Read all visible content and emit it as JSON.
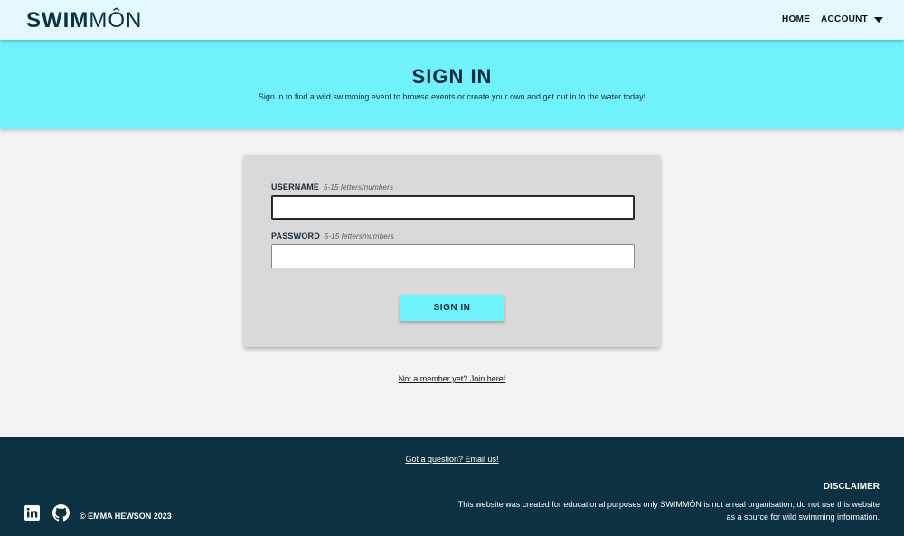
{
  "nav": {
    "brand_bold": "SWIM",
    "brand_light": "MÔN",
    "home_label": "HOME",
    "account_label": "ACCOUNT"
  },
  "hero": {
    "title": "SIGN IN",
    "subtitle": "Sign in to find a wild swimming event to browse events or create your own and get out in to the water today!"
  },
  "form": {
    "username_label": "USERNAME",
    "username_hint": "5-15 letters/numbers",
    "username_value": "",
    "password_label": "PASSWORD",
    "password_hint": "5-15 letters/numbers",
    "password_value": "",
    "submit_label": "SIGN IN"
  },
  "join_link": "Not a member yet? Join here!",
  "footer": {
    "email_link": "Got a question? Email us!",
    "copyright": "© EMMA HEWSON 2023",
    "disclaimer_title": "DISCLAIMER",
    "disclaimer_line1": "This website was created for educational purposes only SWIMMÔN is not a real organisation, do not use this website",
    "disclaimer_line2": "as a source for wild swimming information.",
    "icons": [
      "linkedin-icon",
      "github-icon"
    ]
  },
  "colors": {
    "navbar": "#e4f8fe",
    "accent": "#6ff2fc",
    "footer": "#0b3142",
    "card": "#d9d9d9"
  }
}
